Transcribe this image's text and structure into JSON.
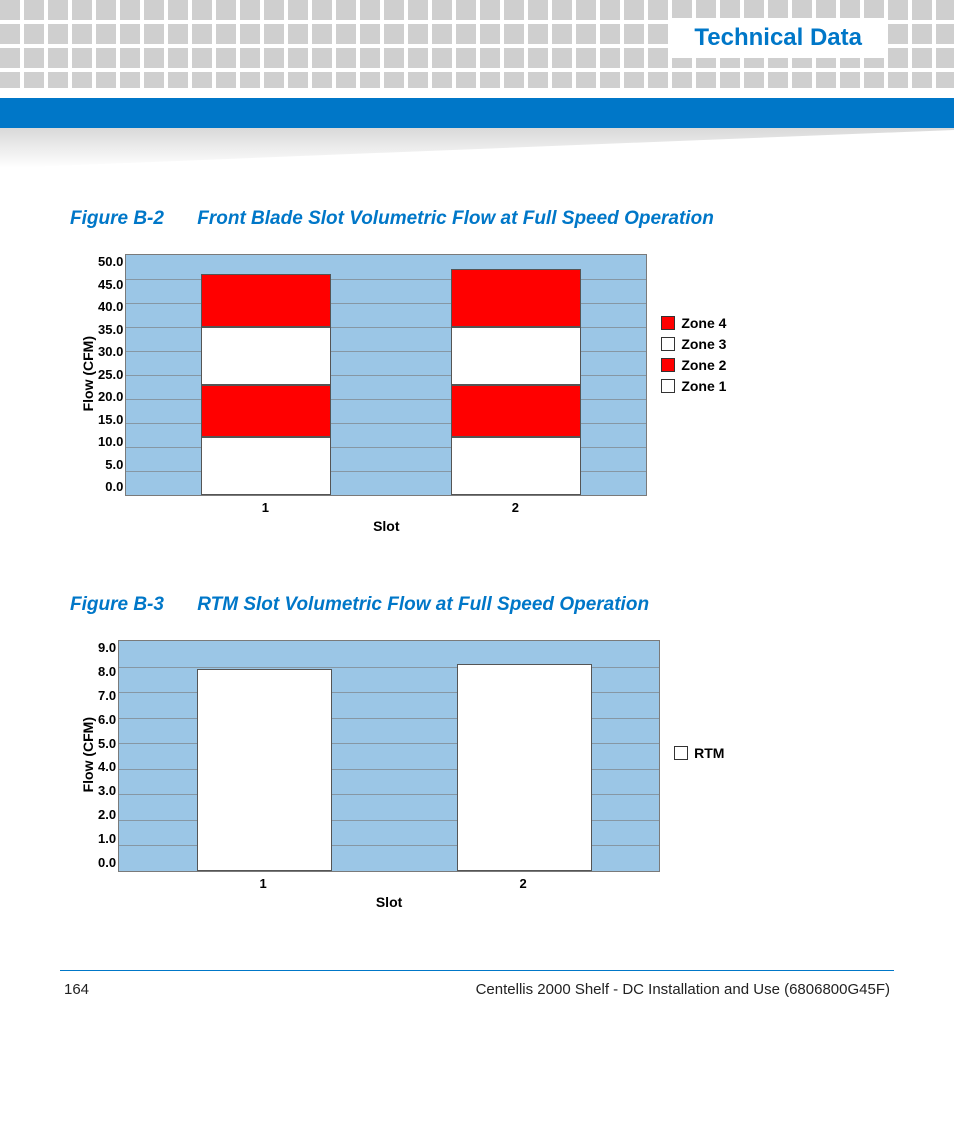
{
  "header": {
    "title": "Technical Data"
  },
  "figure1": {
    "num": "Figure B-2",
    "title": "Front Blade Slot Volumetric Flow at Full Speed Operation"
  },
  "figure2": {
    "num": "Figure B-3",
    "title": "RTM Slot Volumetric Flow at Full Speed Operation"
  },
  "axis": {
    "ylabel": "Flow (CFM)",
    "xlabel": "Slot"
  },
  "legend1": {
    "z4": "Zone 4",
    "z3": "Zone 3",
    "z2": "Zone 2",
    "z1": "Zone 1"
  },
  "legend2": {
    "rtm": "RTM"
  },
  "colors": {
    "red": "#ff0000",
    "white": "#ffffff",
    "plotbg": "#9bc6e6",
    "accent": "#0077c8"
  },
  "footer": {
    "page": "164",
    "doc": "Centellis 2000 Shelf - DC Installation and Use (6806800G45F)"
  },
  "chart_data": [
    {
      "type": "bar",
      "stacked": true,
      "categories": [
        "1",
        "2"
      ],
      "series": [
        {
          "name": "Zone 1",
          "color": "#ffffff",
          "values": [
            12.0,
            12.0
          ]
        },
        {
          "name": "Zone 2",
          "color": "#ff0000",
          "values": [
            11.0,
            11.0
          ]
        },
        {
          "name": "Zone 3",
          "color": "#ffffff",
          "values": [
            12.0,
            12.0
          ]
        },
        {
          "name": "Zone 4",
          "color": "#ff0000",
          "values": [
            11.0,
            12.0
          ]
        }
      ],
      "title": "Front Blade Slot Volumetric Flow at Full Speed Operation",
      "xlabel": "Slot",
      "ylabel": "Flow (CFM)",
      "ylim": [
        0,
        50
      ],
      "ytick_step": 5
    },
    {
      "type": "bar",
      "stacked": false,
      "categories": [
        "1",
        "2"
      ],
      "series": [
        {
          "name": "RTM",
          "color": "#ffffff",
          "values": [
            7.9,
            8.1
          ]
        }
      ],
      "title": "RTM Slot Volumetric Flow at Full Speed Operation",
      "xlabel": "Slot",
      "ylabel": "Flow (CFM)",
      "ylim": [
        0,
        9
      ],
      "ytick_step": 1
    }
  ]
}
